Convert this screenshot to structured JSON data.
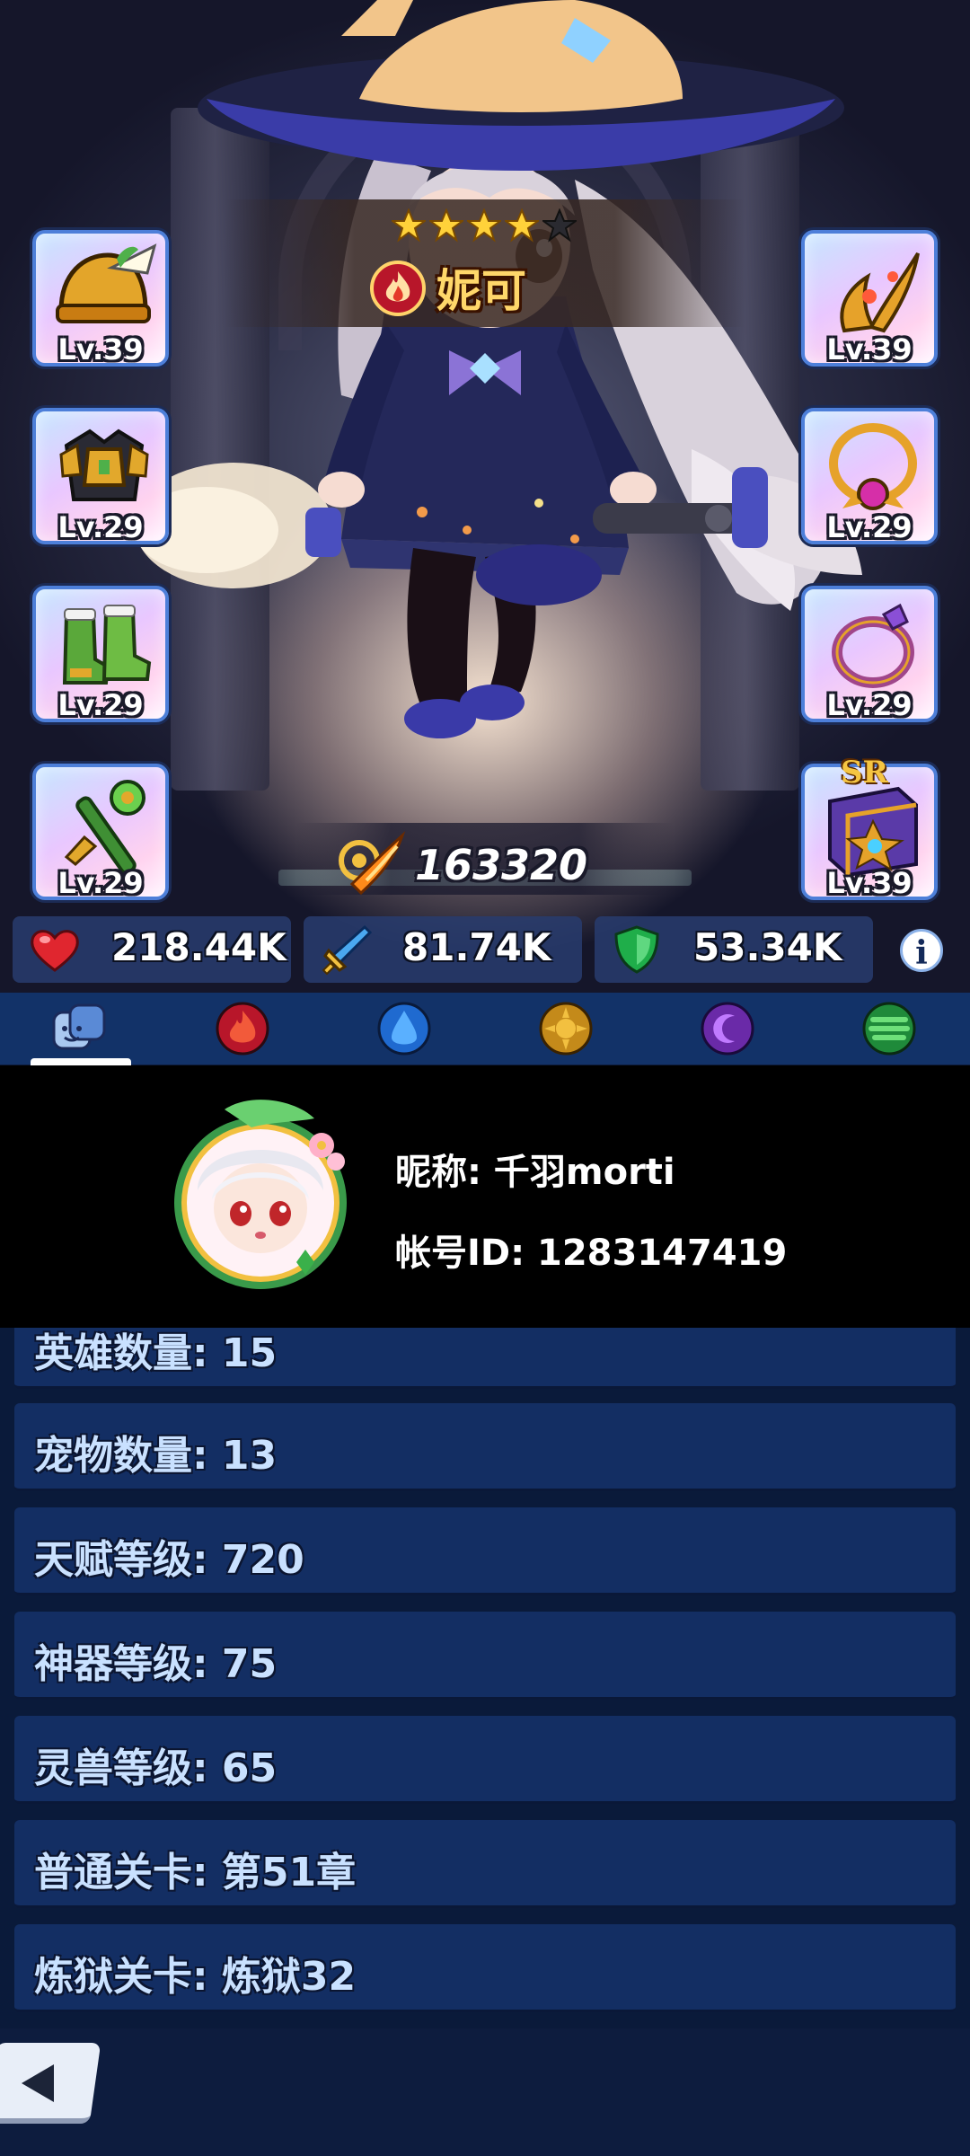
{
  "hero": {
    "name": "妮可",
    "stars_filled": 4,
    "stars_total": 5,
    "element": "fire",
    "power": "163320"
  },
  "equipment": {
    "left": [
      {
        "slot": "helmet",
        "icon": "helmet-icon",
        "level": "Lv.39"
      },
      {
        "slot": "armor",
        "icon": "armor-icon",
        "level": "Lv.29"
      },
      {
        "slot": "boots",
        "icon": "boots-icon",
        "level": "Lv.29"
      },
      {
        "slot": "weapon",
        "icon": "scepter-icon",
        "level": "Lv.29"
      }
    ],
    "right": [
      {
        "slot": "accessory",
        "icon": "horn-charm-icon",
        "level": "Lv.39"
      },
      {
        "slot": "necklace",
        "icon": "necklace-icon",
        "level": "Lv.29"
      },
      {
        "slot": "ring",
        "icon": "ring-icon",
        "level": "Lv.29"
      },
      {
        "slot": "book",
        "icon": "spellbook-icon",
        "level": "Lv.39",
        "rarity": "SR"
      }
    ]
  },
  "stats": {
    "hp": {
      "icon": "heart-icon",
      "value": "218.44K"
    },
    "attack": {
      "icon": "sword-icon",
      "value": "81.74K"
    },
    "defense": {
      "icon": "shield-icon",
      "value": "53.34K"
    }
  },
  "tabs": [
    {
      "name": "all",
      "icon": "hero-face-icon",
      "selected": true
    },
    {
      "name": "fire",
      "icon": "fire-element-icon"
    },
    {
      "name": "water",
      "icon": "water-element-icon"
    },
    {
      "name": "light",
      "icon": "light-element-icon"
    },
    {
      "name": "dark",
      "icon": "dark-element-icon"
    },
    {
      "name": "wind",
      "icon": "wind-element-icon"
    }
  ],
  "profile": {
    "nickname_line": "昵称: 千羽morti",
    "account_line": "帐号ID: 1283147419"
  },
  "info_rows": [
    "英雄数量: 15",
    "宠物数量: 13",
    "天赋等级: 720",
    "神器等级: 75",
    "灵兽等级: 65",
    "普通关卡: 第51章",
    "炼狱关卡: 炼狱32"
  ],
  "colors": {
    "accent": "#ffd76a",
    "panel": "#132e63",
    "tabbar": "#123268",
    "hp": "#e0262f",
    "attack": "#3a86e8",
    "defense": "#1fae4a"
  }
}
